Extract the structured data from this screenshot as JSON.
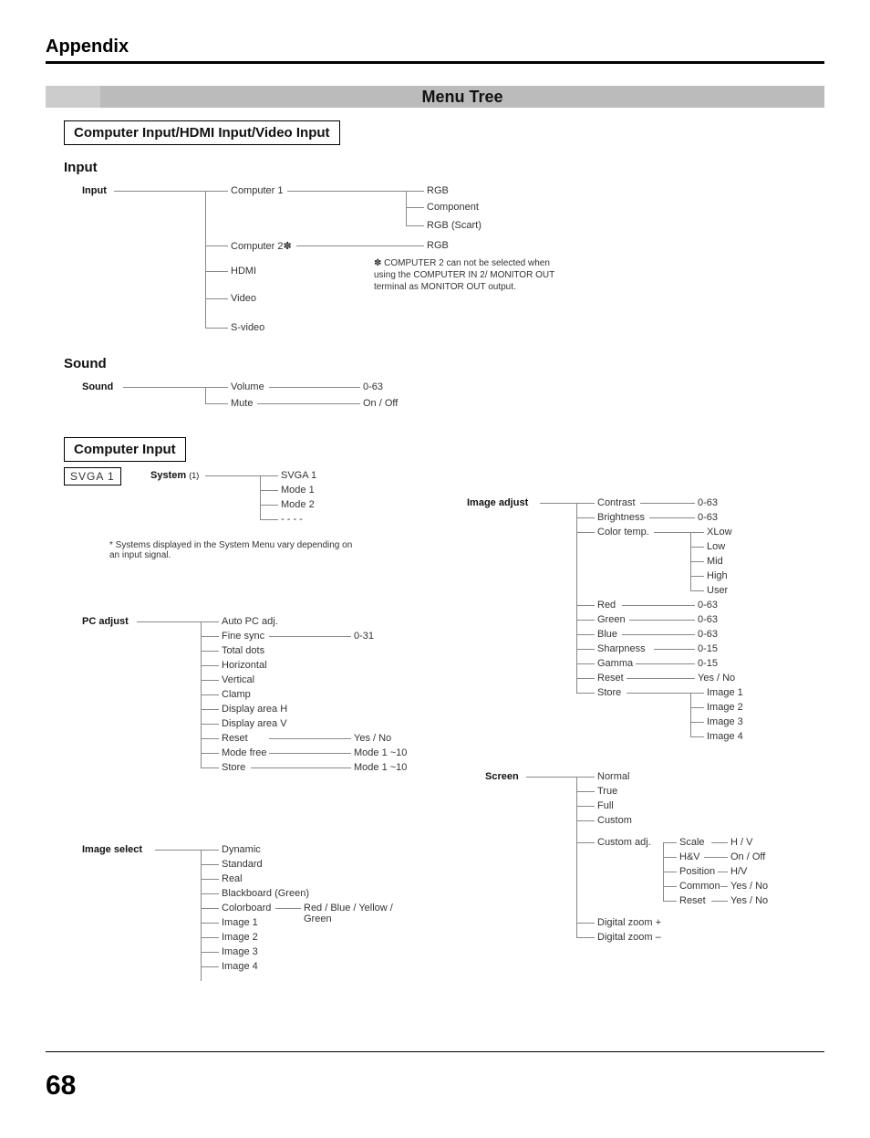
{
  "header": {
    "appendix": "Appendix"
  },
  "title_bar": {
    "label": "Menu Tree"
  },
  "section1": {
    "label": "Computer Input/HDMI Input/Video Input"
  },
  "input": {
    "title": "Input",
    "root": "Input",
    "computer1": "Computer 1",
    "computer2": "Computer 2",
    "computer2_mark": "✽",
    "hdmi": "HDMI",
    "video": "Video",
    "svideo": "S-video",
    "c1_rgb": "RGB",
    "c1_component": "Component",
    "c1_rgbscart": "RGB (Scart)",
    "c2_rgb": "RGB",
    "note": "✽ COMPUTER 2 can not be selected when using the COMPUTER IN 2/ MONITOR OUT terminal as MONITOR OUT output."
  },
  "sound": {
    "title": "Sound",
    "root": "Sound",
    "volume": "Volume",
    "mute": "Mute",
    "volume_range": "0-63",
    "mute_opts": "On / Off"
  },
  "section2": {
    "label": "Computer Input"
  },
  "system": {
    "svga_box": "SVGA 1",
    "label": "System",
    "note_num": "(1)",
    "svga1": "SVGA 1",
    "mode1": "Mode 1",
    "mode2": "Mode 2",
    "dashes": "- - - -",
    "footnote": "* Systems displayed in the System Menu vary depending on an input signal."
  },
  "pc_adjust": {
    "label": "PC adjust",
    "auto": "Auto PC adj.",
    "fine": "Fine sync",
    "fine_range": "0-31",
    "total": "Total dots",
    "horiz": "Horizontal",
    "vert": "Vertical",
    "clamp": "Clamp",
    "disph": "Display area H",
    "dispv": "Display area V",
    "reset": "Reset",
    "reset_opts": "Yes / No",
    "modefree": "Mode free",
    "modefree_range": "Mode 1 ~10",
    "store": "Store",
    "store_range": "Mode 1 ~10"
  },
  "image_select": {
    "label": "Image select",
    "dynamic": "Dynamic",
    "standard": "Standard",
    "real": "Real",
    "blackboard": "Blackboard (Green)",
    "colorboard": "Colorboard",
    "colorboard_opts": "Red / Blue / Yellow / Green",
    "image1": "Image 1",
    "image2": "Image 2",
    "image3": "Image 3",
    "image4": "Image 4"
  },
  "image_adjust": {
    "label": "Image adjust",
    "contrast": "Contrast",
    "contrast_range": "0-63",
    "brightness": "Brightness",
    "brightness_range": "0-63",
    "colortemp": "Color temp.",
    "ct_xlow": "XLow",
    "ct_low": "Low",
    "ct_mid": "Mid",
    "ct_high": "High",
    "ct_user": "User",
    "red": "Red",
    "red_range": "0-63",
    "green": "Green",
    "green_range": "0-63",
    "blue": "Blue",
    "blue_range": "0-63",
    "sharp": "Sharpness",
    "sharp_range": "0-15",
    "gamma": "Gamma",
    "gamma_range": "0-15",
    "reset": "Reset",
    "reset_opts": "Yes / No",
    "store": "Store",
    "store_img1": "Image 1",
    "store_img2": "Image 2",
    "store_img3": "Image 3",
    "store_img4": "Image 4"
  },
  "screen": {
    "label": "Screen",
    "normal": "Normal",
    "true": "True",
    "full": "Full",
    "custom": "Custom",
    "customadj": "Custom adj.",
    "scale": "Scale",
    "scale_opts": "H / V",
    "hv": "H&V",
    "hv_opts": "On / Off",
    "position": "Position",
    "position_opts": "H/V",
    "common": "Common",
    "common_opts": "Yes / No",
    "reset": "Reset",
    "reset_opts": "Yes / No",
    "dzplus": "Digital zoom +",
    "dzminus": "Digital zoom –"
  },
  "page": {
    "number": "68"
  }
}
